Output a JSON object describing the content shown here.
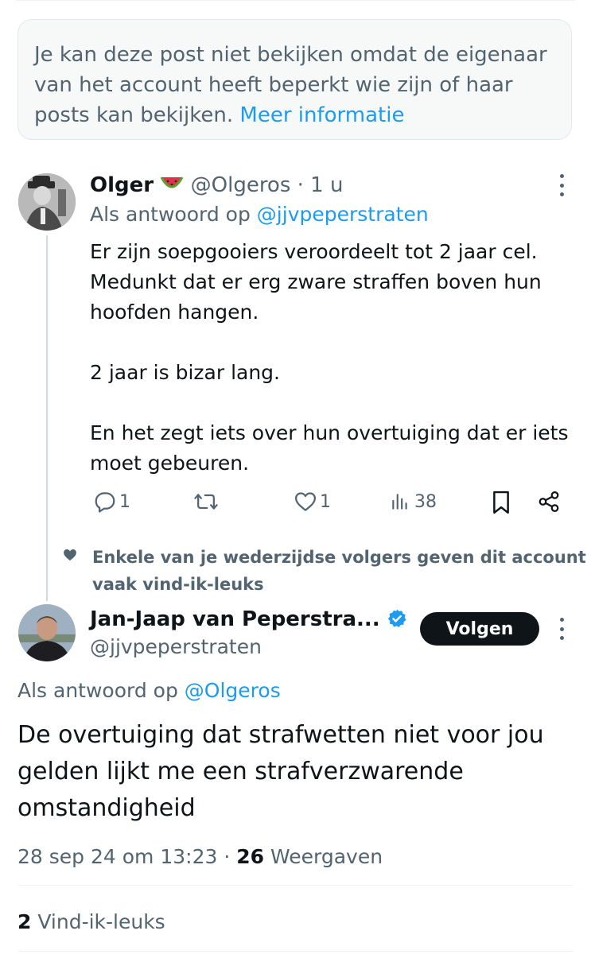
{
  "notice": {
    "text": "Je kan deze post niet bekijken omdat de eigenaar van het account heeft beperkt wie zijn of haar posts kan bekijken.",
    "link": "Meer informatie"
  },
  "reply": {
    "author_name": "Olger",
    "author_emoji": "🍉",
    "handle": "@Olgeros",
    "time": "· 1 u",
    "replying_prefix": "Als antwoord op",
    "replying_to": "@jjvpeperstraten",
    "paragraphs": [
      "Er zijn soepgooiers veroordeelt tot 2 jaar cel. Medunkt dat er erg zware straffen boven hun hoofden hangen.",
      "2 jaar is bizar lang.",
      "En het zegt iets over hun overtuiging dat er iets moet gebeuren."
    ],
    "actions": {
      "replies": "1",
      "likes": "1",
      "views": "38"
    }
  },
  "social_context": "Enkele van je wederzijdse volgers geven dit account vaak vind-ik-leuks",
  "main_post": {
    "author_name": "Jan-Jaap van Peperstra...",
    "handle": "@jjvpeperstraten",
    "follow_label": "Volgen",
    "replying_prefix": "Als antwoord op",
    "replying_to": "@Olgeros",
    "text": "De overtuiging dat strafwetten niet voor jou gelden lijkt me een strafverzwarende omstandigheid",
    "timestamp": "28 sep 24 om 13:23 ·",
    "views_count": "26",
    "views_label": "Weergaven",
    "likes_count": "2",
    "likes_label": "Vind-ik-leuks"
  },
  "colors": {
    "accent": "#1d9bf0",
    "muted": "#536471",
    "text": "#0f1419",
    "verified": "#1d9bf0"
  }
}
